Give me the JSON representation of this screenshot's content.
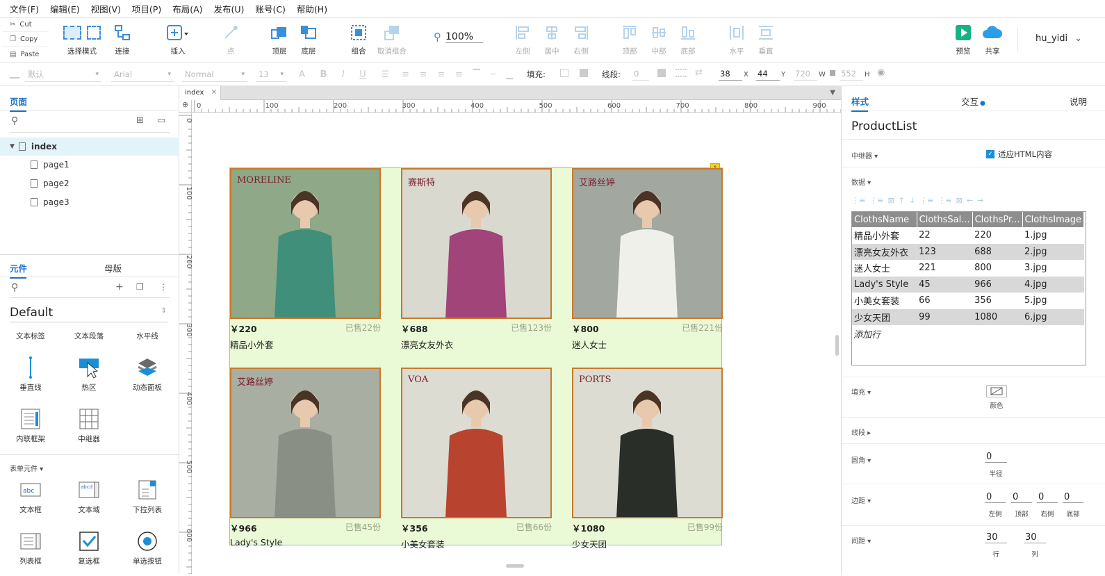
{
  "menubar": [
    "文件(F)",
    "编辑(E)",
    "视图(V)",
    "项目(P)",
    "布局(A)",
    "发布(U)",
    "账号(C)",
    "帮助(H)"
  ],
  "clipboard": {
    "cut": "Cut",
    "copy": "Copy",
    "paste": "Paste"
  },
  "toolbar": {
    "select_mode": "选择模式",
    "connect": "连接",
    "insert": "插入",
    "point": "点",
    "top_layer": "顶层",
    "bottom_layer": "底层",
    "group": "组合",
    "ungroup": "取消组合",
    "zoom": "100%",
    "align_left": "左侧",
    "align_center": "居中",
    "align_right": "右侧",
    "align_top": "顶部",
    "align_middle": "中部",
    "align_bottom": "底部",
    "dist_h": "水平",
    "dist_v": "垂直",
    "preview": "预览",
    "share": "共享",
    "user": "hu_yidi"
  },
  "formatbar": {
    "style": "默认",
    "font": "Arial",
    "weight": "Normal",
    "size": "13",
    "fill_label": "填充:",
    "line_label": "线段:",
    "line_val": "0",
    "x": "38",
    "y": "44",
    "w": "720",
    "h": "552",
    "x_lbl": "X",
    "y_lbl": "Y",
    "w_lbl": "W",
    "h_lbl": "H"
  },
  "pages": {
    "tab": "页面",
    "root": "index",
    "children": [
      "page1",
      "page2",
      "page3"
    ]
  },
  "widgets": {
    "tab_components": "元件",
    "tab_masters": "母版",
    "library": "Default",
    "basic": [
      "文本标签",
      "文本段落",
      "水平线",
      "垂直线",
      "热区",
      "动态面板",
      "内联框架",
      "中继器"
    ],
    "form_title": "表单元件",
    "form": [
      "文本框",
      "文本域",
      "下拉列表",
      "列表框",
      "复选框",
      "单选按钮"
    ]
  },
  "canvas": {
    "tab": "index",
    "ruler_h": [
      "0",
      "100",
      "200",
      "300",
      "400",
      "500",
      "600",
      "700",
      "800",
      "900"
    ],
    "ruler_v": [
      "0",
      "100",
      "200",
      "300",
      "400",
      "500",
      "600"
    ]
  },
  "products": [
    {
      "price": "￥220",
      "sold": "已售22份",
      "name": "精品小外套",
      "brand": "MORELINE",
      "bg": "#8fa887",
      "top": "#3f8f7a"
    },
    {
      "price": "￥688",
      "sold": "已售123份",
      "name": "漂亮女友外衣",
      "brand": "赛斯特",
      "bg": "#d9d9d0",
      "top": "#a0447a"
    },
    {
      "price": "￥800",
      "sold": "已售221份",
      "name": "迷人女士",
      "brand": "艾路丝婷",
      "bg": "#a2a8a0",
      "top": "#f0f0ea"
    },
    {
      "price": "￥966",
      "sold": "已售45份",
      "name": "Lady's Style",
      "brand": "艾路丝婷",
      "bg": "#a9aea3",
      "top": "#8a8f86"
    },
    {
      "price": "￥356",
      "sold": "已售66份",
      "name": "小美女套装",
      "brand": "VOA",
      "bg": "#dcdcd2",
      "top": "#b8432f"
    },
    {
      "price": "￥1080",
      "sold": "已售99份",
      "name": "少女天团",
      "brand": "PORTS",
      "bg": "#dcdcd2",
      "top": "#2a2e28"
    }
  ],
  "inspector": {
    "tab_style": "样式",
    "tab_interact": "交互",
    "tab_notes": "说明",
    "name": "ProductList",
    "repeater_lbl": "中继器",
    "fit_html": "适应HTML内容",
    "data_lbl": "数据",
    "columns": [
      "ClothsName",
      "ClothsSal...",
      "ClothsPr...",
      "ClothsImage"
    ],
    "rows": [
      [
        "精品小外套",
        "22",
        "220",
        "1.jpg"
      ],
      [
        "漂亮女友外衣",
        "123",
        "688",
        "2.jpg"
      ],
      [
        "迷人女士",
        "221",
        "800",
        "3.jpg"
      ],
      [
        "Lady's Style",
        "45",
        "966",
        "4.jpg"
      ],
      [
        "小美女套装",
        "66",
        "356",
        "5.jpg"
      ],
      [
        "少女天团",
        "99",
        "1080",
        "6.jpg"
      ]
    ],
    "add_row": "添加行",
    "fill_lbl": "填充",
    "color_lbl": "颜色",
    "line_lbl": "线段",
    "radius_lbl": "圆角",
    "radius_val": "0",
    "radius_cap": "半径",
    "padding_lbl": "边距",
    "padding": [
      "0",
      "0",
      "0",
      "0"
    ],
    "padding_caps": [
      "左侧",
      "顶部",
      "右侧",
      "底部"
    ],
    "spacing_lbl": "间距",
    "spacing": [
      "30",
      "30"
    ],
    "spacing_caps": [
      "行",
      "列"
    ]
  }
}
